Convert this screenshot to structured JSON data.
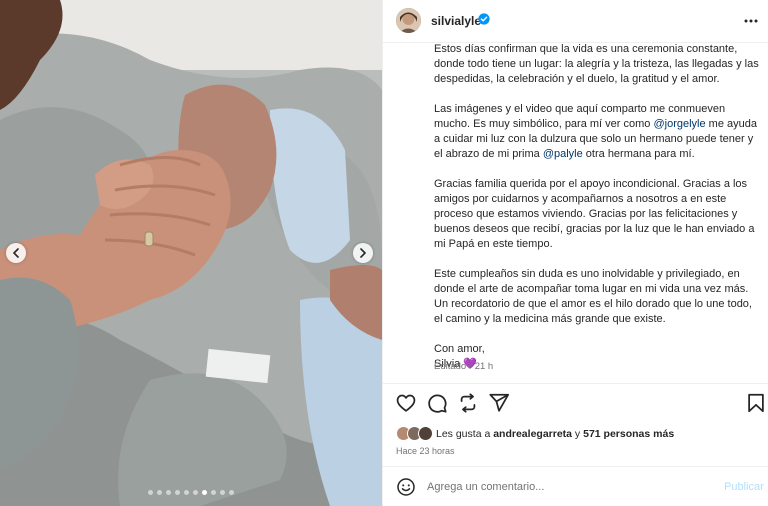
{
  "post": {
    "username": "silvialyle",
    "verified": true,
    "caption": {
      "p1": "Estos días confirman que la vida es una ceremonia constante, donde todo tiene un lugar: la alegría y la tristeza, las llegadas y las despedidas, la celebración y el duelo, la gratitud y el amor.",
      "p2_a": "Las imágenes y el video que aquí comparto me conmueven mucho. Es muy simbólico, para mí ver como ",
      "p2_mention1": "@jorgelyle",
      "p2_b": " me ayuda a cuidar mi luz con la dulzura que solo un hermano puede tener y el abrazo de mi prima ",
      "p2_mention2": "@palyle",
      "p2_c": " otra hermana para mí.",
      "p3": "Gracias familia querida por el apoyo incondicional. Gracias a los amigos por cuidarnos y acompañarnos a nosotros a en este proceso que estamos viviendo. Gracias por las felicitaciones y buenos deseos que recibí, gracias por la luz que le han enviado a mi Papá en este tiempo.",
      "p4": "Este cumpleaños sin duda es uno inolvidable y privilegiado, en donde el arte de acompañar toma lugar en mi vida una vez más. Un recordatorio de que el amor es el hilo dorado que lo une todo, el camino y la medicina más grande que existe.",
      "closing": "Con amor,",
      "signature": "Silvia",
      "signature_emoji": "💜"
    },
    "edited_label": "Editado",
    "edited_sep": "·",
    "edited_time": "21 h",
    "likes": {
      "prefix": "Les gusta a ",
      "user": "andrealegarreta",
      "middle": " y ",
      "count": "571 personas más"
    },
    "posted_ago": "Hace 23 horas",
    "comment": {
      "placeholder": "Agrega un comentario...",
      "publish_label": "Publicar"
    }
  },
  "carousel": {
    "total_slides": 10,
    "active_index": 6
  },
  "icons": {
    "more": "more-options-icon",
    "like": "heart-icon",
    "comment": "comment-icon",
    "share": "share-icon",
    "send": "send-icon",
    "save": "bookmark-icon",
    "emoji": "emoji-icon",
    "prev": "chevron-left-icon",
    "next": "chevron-right-icon",
    "verified": "verified-badge-icon"
  },
  "colors": {
    "link": "#00376b",
    "verified": "#0095f6",
    "muted": "#737373",
    "publish_disabled": "#b2dffc"
  }
}
